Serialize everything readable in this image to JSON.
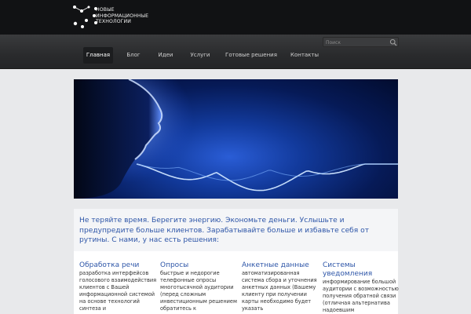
{
  "header": {
    "logo_lines": [
      "НОВЫЕ",
      "ИНФОРМАЦИОННЫЕ",
      "ТЕХНОЛОГИИ"
    ]
  },
  "search": {
    "placeholder": "Поиск",
    "icon": "search-icon"
  },
  "nav": {
    "items": [
      {
        "label": "Главная",
        "active": true
      },
      {
        "label": "Блог",
        "active": false
      },
      {
        "label": "Идеи",
        "active": false
      },
      {
        "label": "Услуги",
        "active": false
      },
      {
        "label": "Готовые решения",
        "active": false
      },
      {
        "label": "Контакты",
        "active": false
      }
    ]
  },
  "intro": {
    "text": "Не теряйте время. Берегите энергию. Экономьте деньги. Услышьте и предупредите больше клиентов. Зарабатывайте больше и избавьте себя от рутины. С нами, у нас есть решения:"
  },
  "features": [
    {
      "title": "Обработка речи",
      "text": "разработка интерфейсов голосового взаимодействия клиентов с Вашей информационной системой на основе технологий синтеза и"
    },
    {
      "title": "Опросы",
      "text": "быстрые и недорогие телефонные опросы многотысячной аудитории (перед сложным инвестиционным решением обратитесь к"
    },
    {
      "title": "Анкетные данные",
      "text": "автоматизированная система сбора и уточнения анкетных данных (Вашему клиенту при получении карты необходимо будет указать"
    },
    {
      "title": "Системы уведомления",
      "text": "информирование большой аудитории с возможностью получения обратной связи (отличная альтернатива надоевшим"
    }
  ],
  "colors": {
    "topbar": "#111214",
    "accent": "#2e56a8",
    "hero_glow": "#2a5dd6"
  }
}
